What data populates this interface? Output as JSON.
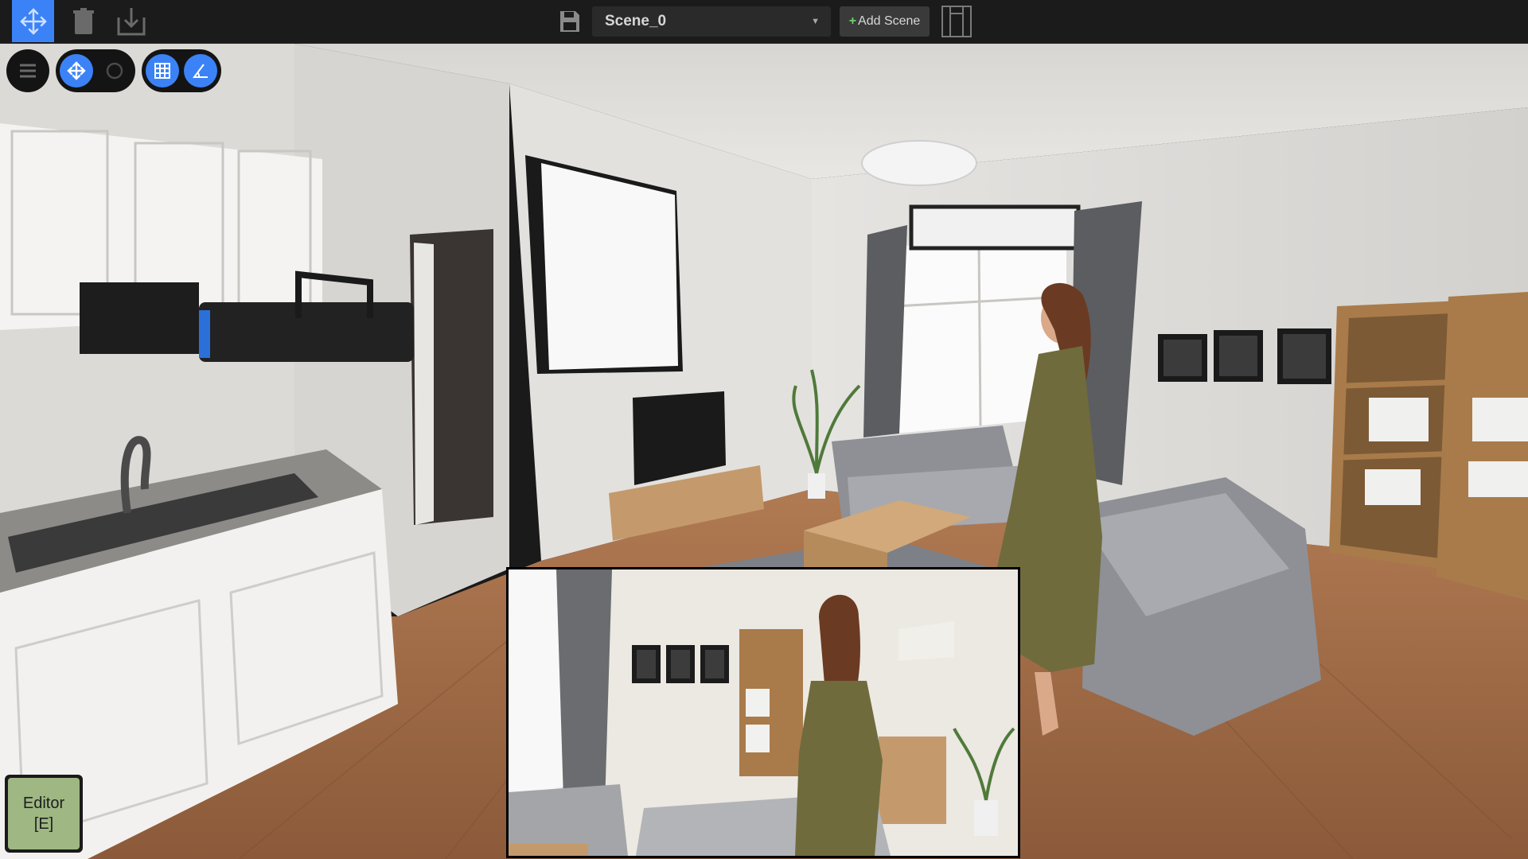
{
  "toolbar": {
    "move_icon": "move-arrows-icon",
    "trash_icon": "trash-icon",
    "import_icon": "import-icon",
    "save_icon": "floppy-disk-icon",
    "scene_select": {
      "value": "Scene_0"
    },
    "add_scene_label": "Add Scene",
    "layout_icon": "layout-panels-icon",
    "accent": "#3b82f6"
  },
  "viewport_tools": {
    "menu_icon": "list-menu-icon",
    "move_icon": "move-arrows-icon",
    "rotate_icon": "rotate-icon",
    "grid_icon": "grid-snap-icon",
    "angle_icon": "angle-snap-icon"
  },
  "editor_button": {
    "label": "Editor",
    "shortcut": "[E]",
    "color": "#9eb783"
  }
}
